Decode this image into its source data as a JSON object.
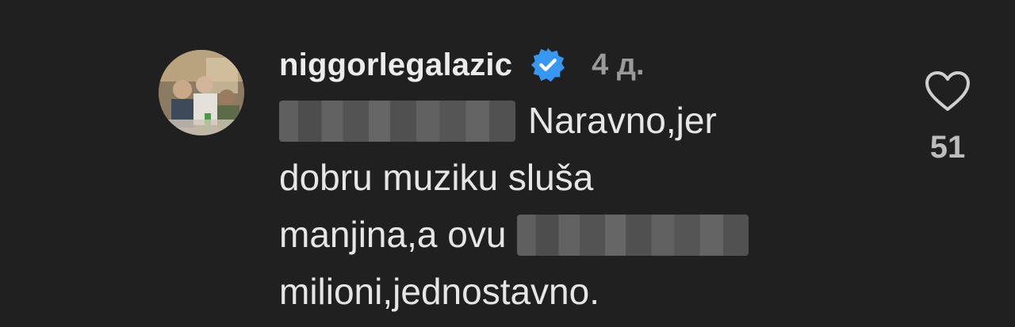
{
  "comment": {
    "avatar_icon": "profile-photo",
    "username": "niggorlegalazic",
    "verified_icon": "verified-badge-icon",
    "verified_color": "#3897f0",
    "timestamp": "4 д.",
    "lines": {
      "line1_text": "Naravno,jer",
      "line2_text": "dobru muziku sluša",
      "line3_text": "manjina,a ovu",
      "line4_text": "milioni,jednostavno."
    },
    "like_icon": "heart-outline-icon",
    "like_count": "51"
  },
  "colors": {
    "background": "#202020",
    "text": "#e6e6e6",
    "muted": "#9a9a9a"
  }
}
